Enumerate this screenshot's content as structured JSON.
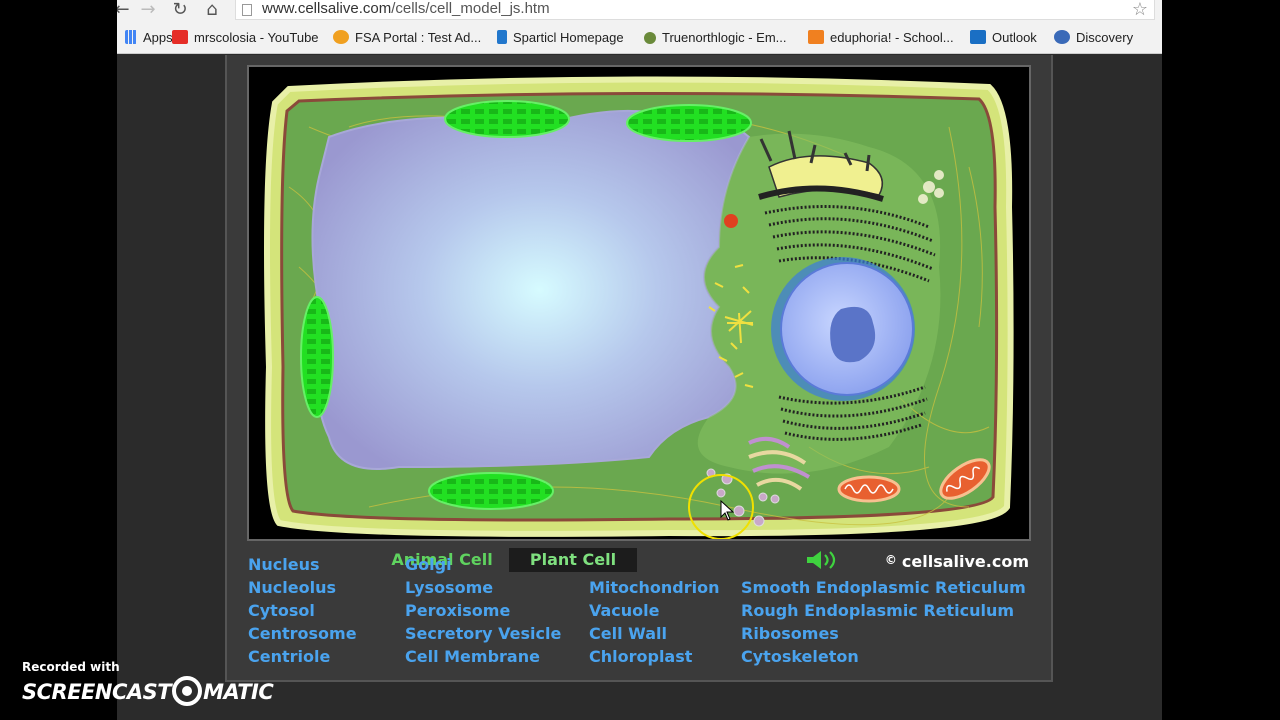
{
  "browser": {
    "url_host": "www.cellsalive.com",
    "url_path": "/cells/cell_model_js.htm",
    "bookmarks": [
      {
        "label": "Apps",
        "icon": "apps-grid-icon",
        "color": "#4285f4"
      },
      {
        "label": "mrscolosia - YouTube",
        "icon": "youtube-icon",
        "color": "#e52d27"
      },
      {
        "label": "FSA Portal : Test Ad...",
        "icon": "fsa-icon",
        "color": "#f0a020"
      },
      {
        "label": "Sparticl Homepage",
        "icon": "sparticl-icon",
        "color": "#2277cc"
      },
      {
        "label": "Truenorthlogic - Em...",
        "icon": "truenorth-icon",
        "color": "#6a8a3a"
      },
      {
        "label": "eduphoria! - School...",
        "icon": "eduphoria-icon",
        "color": "#f08020"
      },
      {
        "label": "Outlook",
        "icon": "outlook-icon",
        "color": "#1a6fc4"
      },
      {
        "label": "Discovery",
        "icon": "discovery-icon",
        "color": "#3a6ab8"
      }
    ]
  },
  "model": {
    "tabs": [
      {
        "label": "Animal Cell",
        "active": false
      },
      {
        "label": "Plant Cell",
        "active": true
      }
    ],
    "sound_icon": "speaker-icon",
    "copyright_symbol": "©",
    "copyright": "cellsalive.com"
  },
  "organelle_links": {
    "col1": [
      "Nucleus",
      "Nucleolus",
      "Cytosol",
      "Centrosome",
      "Centriole"
    ],
    "col2": [
      "Golgi",
      "Lysosome",
      "Peroxisome",
      "Secretory Vesicle",
      "Cell Membrane"
    ],
    "col3": [
      "Mitochondrion",
      "Vacuole",
      "Cell Wall",
      "Chloroplast"
    ],
    "col4": [
      "Smooth Endoplasmic Reticulum",
      "Rough Endoplasmic Reticulum",
      "Ribosomes",
      "Cytoskeleton"
    ]
  },
  "watermark": {
    "line1": "Recorded with",
    "logo_left": "SCREENCAST",
    "logo_right": "MATIC"
  },
  "colors": {
    "link": "#4aa3ee",
    "tab_text": "#5fd35f",
    "cytoplasm": "#6aa84f",
    "cell_wall": "#d8e68a",
    "chloroplast": "#22dd22",
    "vacuole": "#b8c4e8",
    "nucleus": "#8fa8f0"
  }
}
